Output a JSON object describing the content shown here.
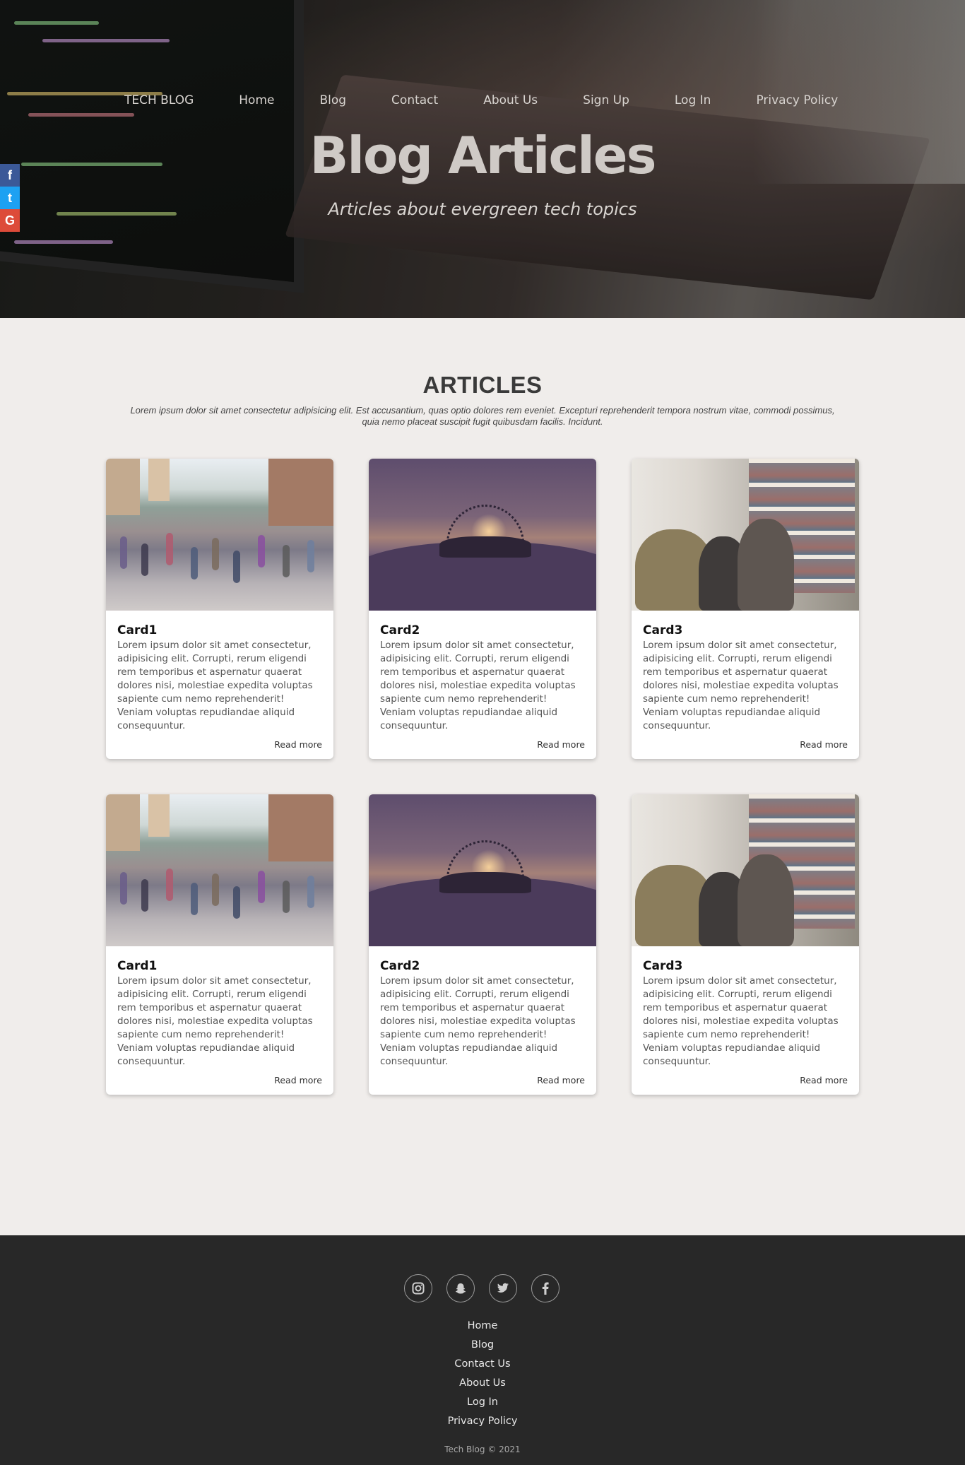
{
  "nav": {
    "brand": "TECH BLOG",
    "links": [
      "Home",
      "Blog",
      "Contact",
      "About Us",
      "Sign Up",
      "Log In",
      "Privacy Policy"
    ]
  },
  "hero": {
    "title": "Blog Articles",
    "subtitle": "Articles about evergreen tech topics"
  },
  "share": {
    "facebook_glyph": "f",
    "twitter_glyph": "t",
    "google_glyph": "G"
  },
  "articles": {
    "heading": "ARTICLES",
    "intro": "Lorem ipsum dolor sit amet consectetur adipisicing elit. Est accusantium, quas optio dolores rem eveniet. Excepturi reprehenderit tempora nostrum vitae, commodi possimus, quia nemo placeat suscipit fugit quibusdam facilis. Incidunt.",
    "cards": [
      {
        "title": "Card1",
        "image": "crowd-street-image",
        "text": "Lorem ipsum dolor sit amet consectetur, adipisicing elit. Corrupti, rerum eligendi rem temporibus et aspernatur quaerat dolores nisi, molestiae expedita voluptas sapiente cum nemo reprehenderit! Veniam voluptas repudiandae aliquid consequuntur.",
        "more": "Read more"
      },
      {
        "title": "Card2",
        "image": "sunset-hill-image",
        "text": "Lorem ipsum dolor sit amet consectetur, adipisicing elit. Corrupti, rerum eligendi rem temporibus et aspernatur quaerat dolores nisi, molestiae expedita voluptas sapiente cum nemo reprehenderit! Veniam voluptas repudiandae aliquid consequuntur.",
        "more": "Read more"
      },
      {
        "title": "Card3",
        "image": "library-study-image",
        "text": "Lorem ipsum dolor sit amet consectetur, adipisicing elit. Corrupti, rerum eligendi rem temporibus et aspernatur quaerat dolores nisi, molestiae expedita voluptas sapiente cum nemo reprehenderit! Veniam voluptas repudiandae aliquid consequuntur.",
        "more": "Read more"
      },
      {
        "title": "Card1",
        "image": "crowd-street-image",
        "text": "Lorem ipsum dolor sit amet consectetur, adipisicing elit. Corrupti, rerum eligendi rem temporibus et aspernatur quaerat dolores nisi, molestiae expedita voluptas sapiente cum nemo reprehenderit! Veniam voluptas repudiandae aliquid consequuntur.",
        "more": "Read more"
      },
      {
        "title": "Card2",
        "image": "sunset-hill-image",
        "text": "Lorem ipsum dolor sit amet consectetur, adipisicing elit. Corrupti, rerum eligendi rem temporibus et aspernatur quaerat dolores nisi, molestiae expedita voluptas sapiente cum nemo reprehenderit! Veniam voluptas repudiandae aliquid consequuntur.",
        "more": "Read more"
      },
      {
        "title": "Card3",
        "image": "library-study-image",
        "text": "Lorem ipsum dolor sit amet consectetur, adipisicing elit. Corrupti, rerum eligendi rem temporibus et aspernatur quaerat dolores nisi, molestiae expedita voluptas sapiente cum nemo reprehenderit! Veniam voluptas repudiandae aliquid consequuntur.",
        "more": "Read more"
      }
    ]
  },
  "footer": {
    "social_icons": [
      "instagram-icon",
      "snapchat-icon",
      "twitter-icon",
      "facebook-icon"
    ],
    "links": [
      "Home",
      "Blog",
      "Contact Us",
      "About Us",
      "Log In",
      "Privacy Policy"
    ],
    "copyright": "Tech Blog © 2021"
  },
  "colors": {
    "page_bg": "#f0edeb",
    "footer_bg": "#282828",
    "facebook": "#3b5998",
    "twitter": "#1da1f2",
    "google": "#dd4b39"
  }
}
